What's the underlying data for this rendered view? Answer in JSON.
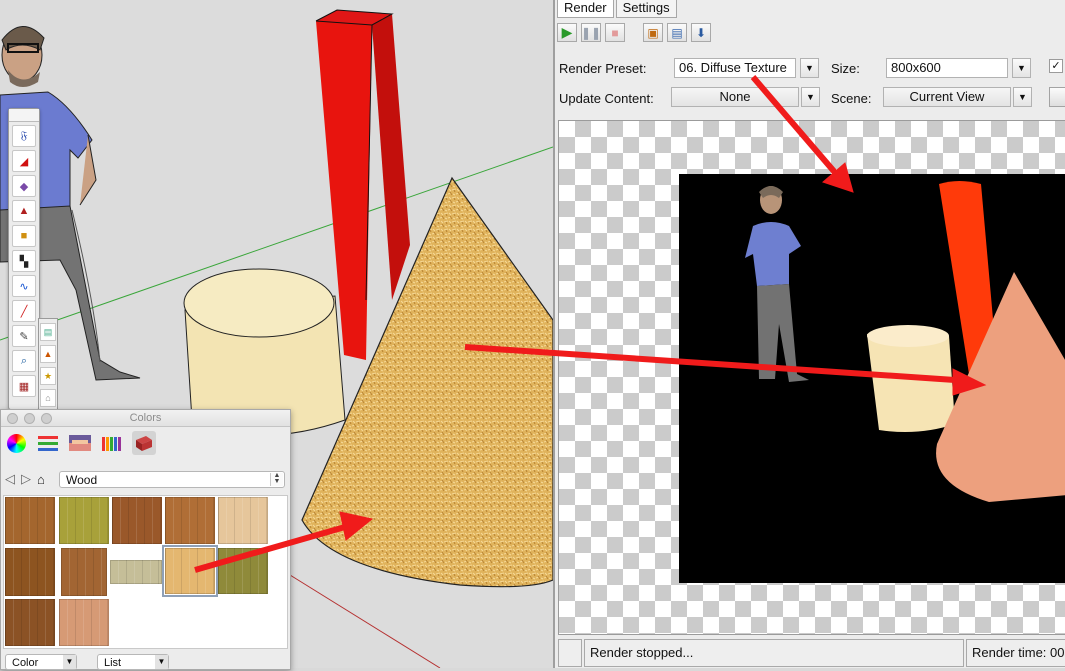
{
  "render_window": {
    "tabs": [
      {
        "label": "Render",
        "active": true
      },
      {
        "label": "Settings",
        "active": false
      }
    ],
    "toolbar": {
      "icons": [
        "play-icon",
        "pause-icon",
        "stop-icon",
        "save-render-icon",
        "export-render-icon",
        "render-settings-icon"
      ]
    },
    "render_preset": {
      "label": "Render Preset:",
      "value": "06. Diffuse Texture"
    },
    "size": {
      "label": "Size:",
      "value": "800x600"
    },
    "update_content": {
      "label": "Update Content:",
      "value": "None"
    },
    "scene": {
      "label": "Scene:",
      "value": "Current View"
    },
    "checkbox_mark": "✓",
    "status": {
      "message": "Render stopped...",
      "render_time": "Render time: 00"
    }
  },
  "colors_panel": {
    "title": "Colors",
    "category": "Wood",
    "bottom_left_select": "Color",
    "bottom_right_select": "List",
    "mode_icons": [
      "color-wheel-icon",
      "color-sliders-icon",
      "color-palettes-icon",
      "crayons-icon",
      "brick-texture-icon"
    ],
    "swatches": [
      {
        "color": "#a4662e"
      },
      {
        "color": "#a8a13a"
      },
      {
        "color": "#9a582a"
      },
      {
        "color": "#b06e36"
      },
      {
        "color": "#e6c69b"
      },
      {
        "color": "#8d5420"
      },
      {
        "color": "#a26533"
      },
      {
        "color": "#c5be98"
      },
      {
        "color": "#e4b770",
        "selected": true
      },
      {
        "color": "#8f8a3a"
      },
      {
        "color": "#8b5225"
      },
      {
        "color": "#d69a75"
      }
    ]
  },
  "colors": {
    "accent_red": "#e3111a",
    "arrow_red": "#f01b1b",
    "render_bg": "#000000"
  }
}
